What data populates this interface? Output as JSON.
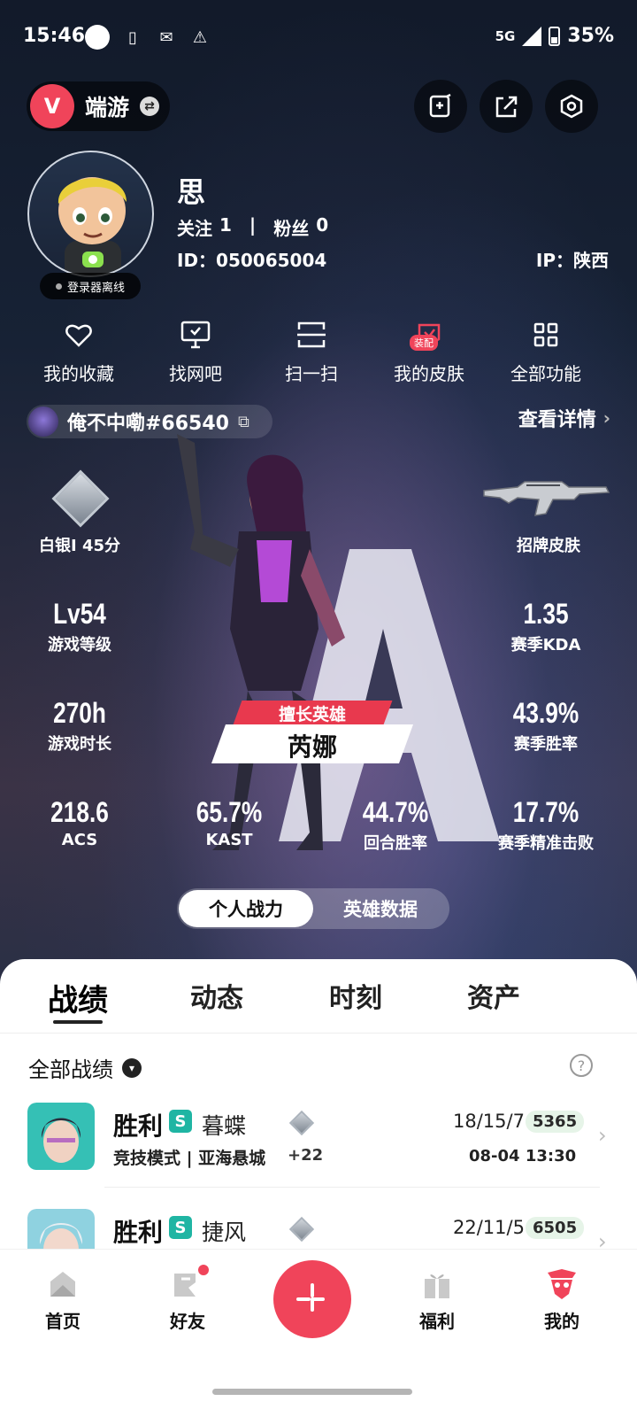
{
  "status_bar": {
    "time": "15:46",
    "network": "5G",
    "battery": "35%"
  },
  "header": {
    "app_name": "端游",
    "logo_letter": "V",
    "buttons": [
      "edit-card-icon",
      "share-icon",
      "settings-icon"
    ]
  },
  "profile": {
    "name": "思",
    "following_label": "关注",
    "following": "1",
    "separator": "|",
    "fans_label": "粉丝",
    "fans": "0",
    "id_text": "ID：050065004",
    "ip_text": "IP：陕西",
    "login_status": "登录器离线"
  },
  "quick_actions": [
    {
      "label": "我的收藏",
      "icon": "heart-icon"
    },
    {
      "label": "找网吧",
      "icon": "monitor-icon"
    },
    {
      "label": "扫一扫",
      "icon": "scan-icon"
    },
    {
      "label": "我的皮肤",
      "icon": "skin-icon",
      "badge": "装配"
    },
    {
      "label": "全部功能",
      "icon": "grid-icon"
    }
  ],
  "riot": {
    "name": "俺不中嘞#66540",
    "details": "查看详情"
  },
  "stats": {
    "rank": "白银I 45分",
    "skin_label": "招牌皮肤",
    "level_value": "Lv54",
    "level_label": "游戏等级",
    "kda_value": "1.35",
    "kda_label": "赛季KDA",
    "hours_value": "270h",
    "hours_label": "游戏时长",
    "winrate_value": "43.9%",
    "winrate_label": "赛季胜率",
    "acs_value": "218.6",
    "acs_label": "ACS",
    "kast_value": "65.7%",
    "kast_label": "KAST",
    "round_value": "44.7%",
    "round_label": "回合胜率",
    "hs_value": "17.7%",
    "hs_label": "赛季精准击败"
  },
  "hero": {
    "tag": "擅长英雄",
    "name": "芮娜"
  },
  "toggle": {
    "active": "个人战力",
    "inactive": "英雄数据"
  },
  "tabs": [
    "战绩",
    "动态",
    "时刻",
    "资产"
  ],
  "filter": {
    "label": "全部战绩"
  },
  "matches": [
    {
      "result": "胜利",
      "mode_chip": "S",
      "hero": "暮蝶",
      "mode_map": "竞技模式 | 亚海悬城",
      "rr": "+22",
      "kda": "18/15/7",
      "score": "5365",
      "date": "08-04 13:30"
    },
    {
      "result": "胜利",
      "mode_chip": "S",
      "hero": "捷风",
      "kda": "22/11/5",
      "score": "6505"
    }
  ],
  "nav": [
    {
      "label": "首页",
      "icon": "home-icon"
    },
    {
      "label": "好友",
      "icon": "friends-icon"
    },
    {
      "label": "福利",
      "icon": "gift-icon"
    },
    {
      "label": "我的",
      "icon": "profile-icon"
    }
  ],
  "colors": {
    "accent": "#f0445a",
    "teal": "#1fb5a3"
  }
}
